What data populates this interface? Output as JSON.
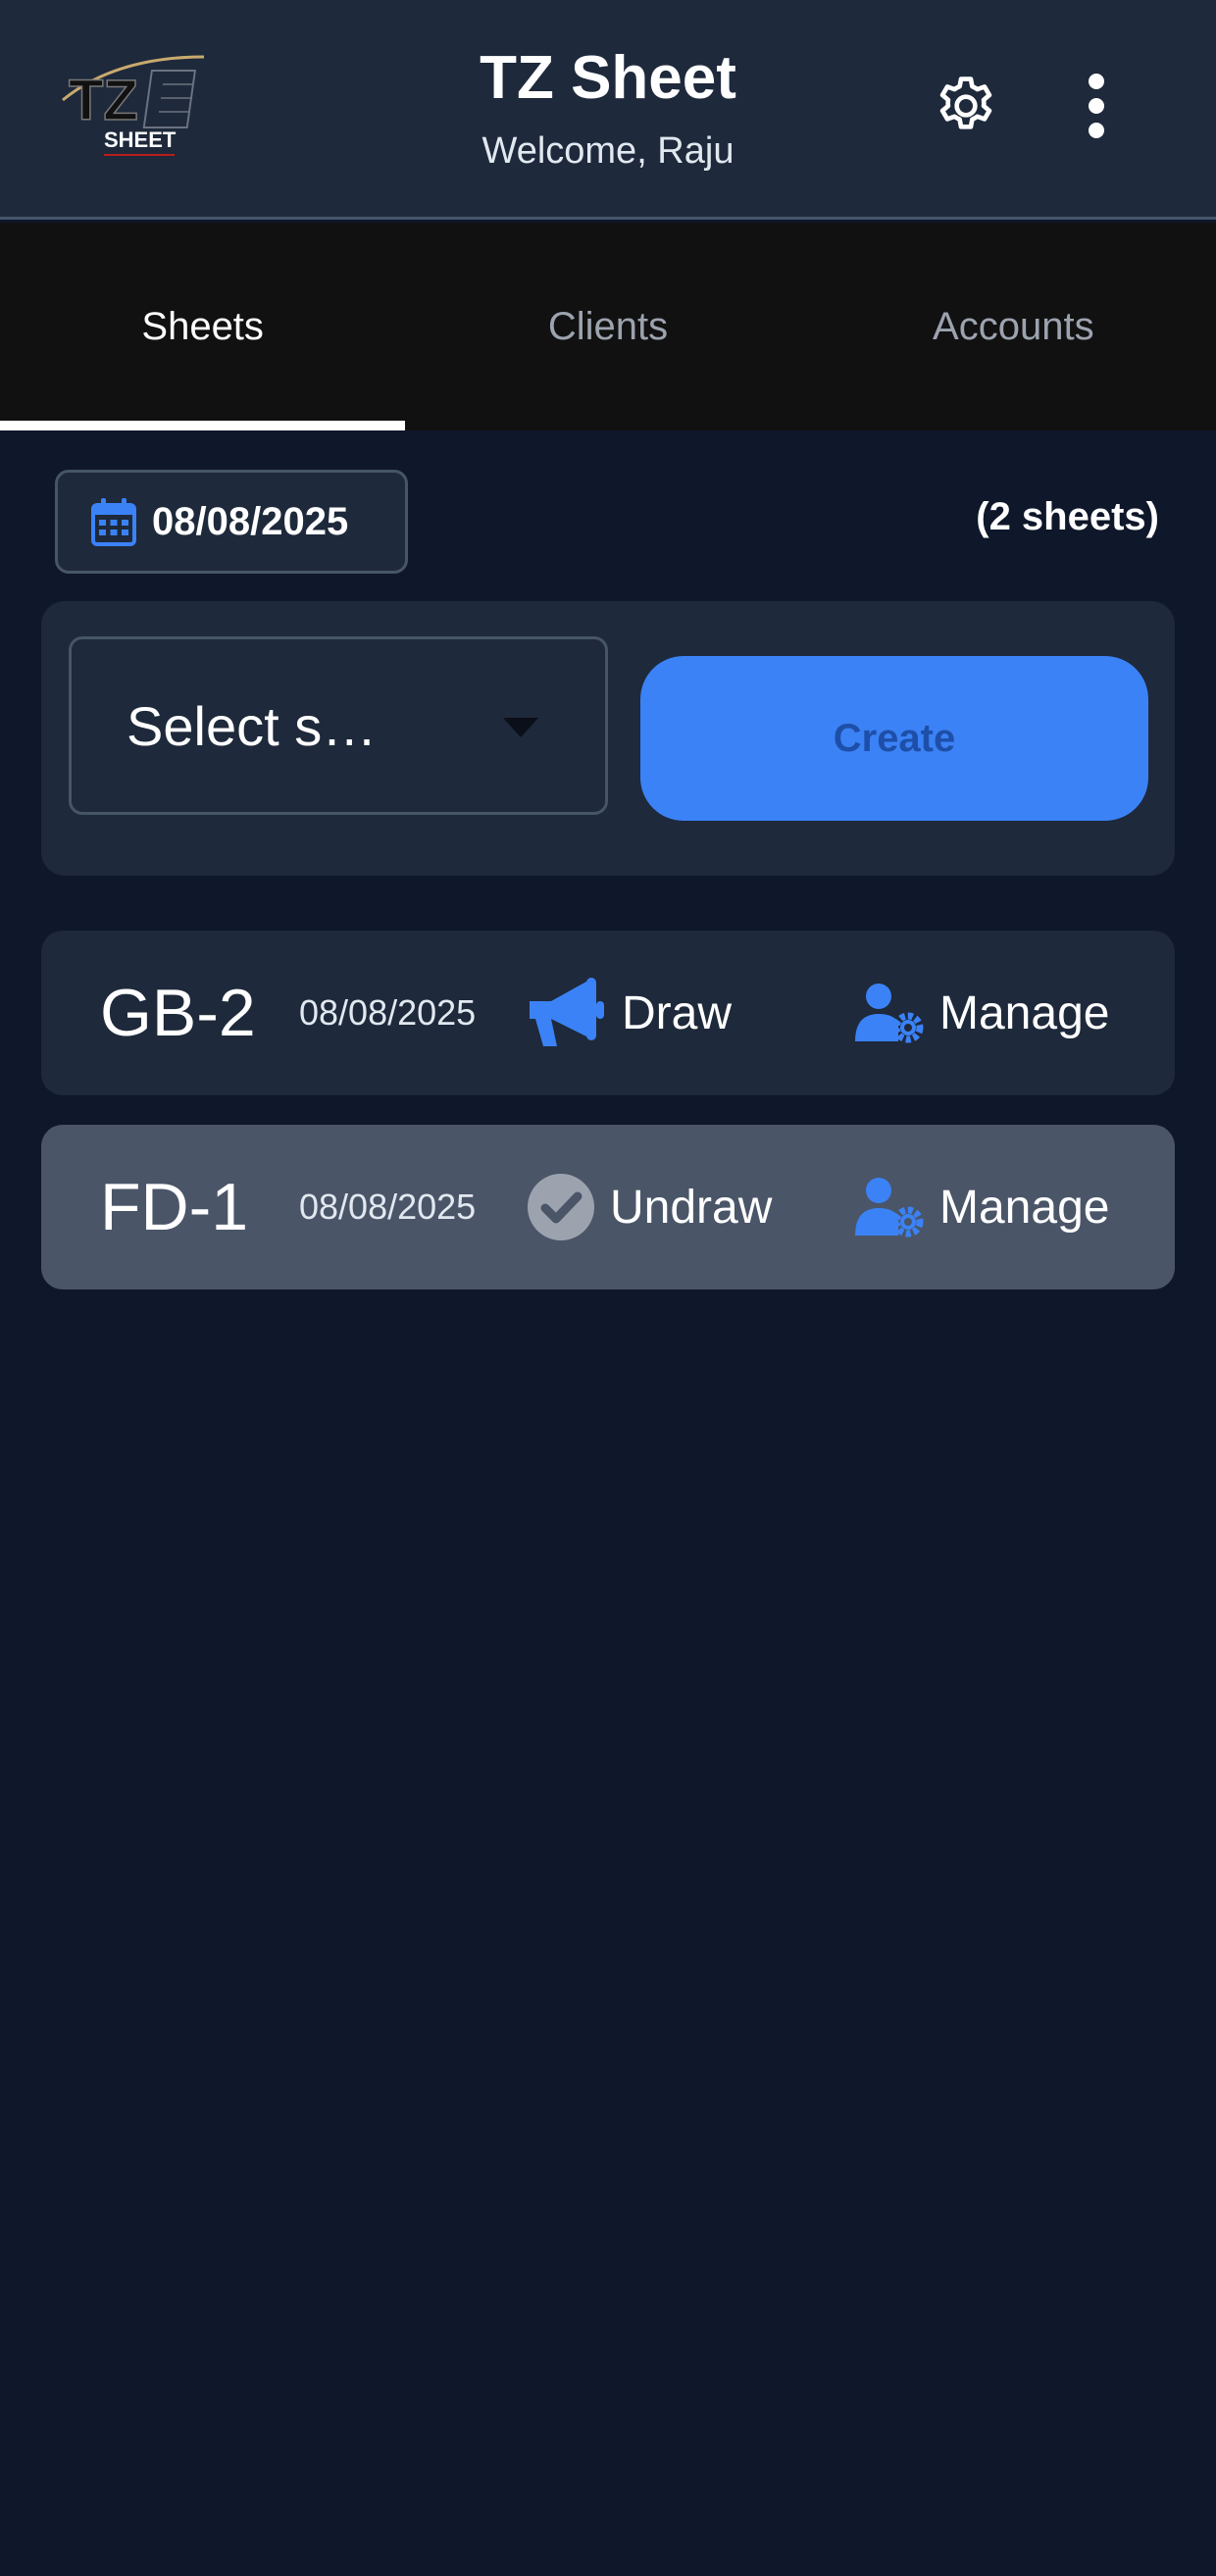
{
  "header": {
    "logo_text": "TZ SHEET",
    "title": "TZ Sheet",
    "subtitle": "Welcome, Raju",
    "settings_icon": "gear-icon",
    "more_icon": "more-vertical-icon"
  },
  "tabs": [
    {
      "label": "Sheets",
      "active": true
    },
    {
      "label": "Clients",
      "active": false
    },
    {
      "label": "Accounts",
      "active": false
    }
  ],
  "date_filter": {
    "icon": "calendar-icon",
    "value": "08/08/2025"
  },
  "sheet_count": "(2 sheets)",
  "create_form": {
    "select_value": "Select s…",
    "create_label": "Create"
  },
  "sheets": [
    {
      "name": "GB-2",
      "date": "08/08/2025",
      "action_label": "Draw",
      "action_icon": "megaphone-icon",
      "manage_label": "Manage",
      "manage_icon": "user-gear-icon"
    },
    {
      "name": "FD-1",
      "date": "08/08/2025",
      "action_label": "Undraw",
      "action_icon": "check-circle-icon",
      "manage_label": "Manage",
      "manage_icon": "user-gear-icon"
    }
  ],
  "colors": {
    "background": "#0f172a",
    "card": "#1e293b",
    "accent": "#3b82f6",
    "drawn_row": "#4a5568"
  }
}
